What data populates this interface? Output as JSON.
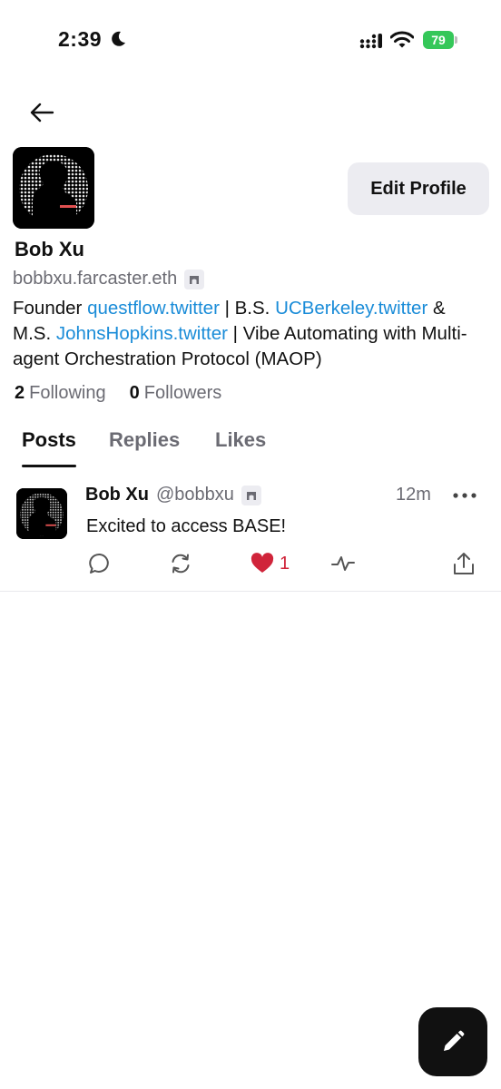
{
  "status_bar": {
    "time": "2:39",
    "battery": "79"
  },
  "profile": {
    "display_name": "Bob Xu",
    "handle": "bobbxu.farcaster.eth",
    "edit_label": "Edit Profile",
    "bio": {
      "founder_prefix": "Founder ",
      "link_questflow": "questflow.twitter",
      "bs_text": " | B.S. ",
      "link_berkeley": "UCBerkeley.twitter",
      "ms_text": " & M.S. ",
      "link_jhu": "JohnsHopkins.twitter",
      "suffix": " | Vibe Automating with Multi-agent Orchestration Protocol (MAOP)"
    },
    "following_count": "2",
    "following_label": "Following",
    "followers_count": "0",
    "followers_label": "Followers"
  },
  "tabs": {
    "posts": "Posts",
    "replies": "Replies",
    "likes": "Likes"
  },
  "post": {
    "author": "Bob Xu",
    "handle": "@bobbxu",
    "time": "12m",
    "text": "Excited to access BASE!",
    "like_count": "1"
  },
  "colors": {
    "link": "#1a8cd8",
    "like": "#d0243a",
    "battery": "#35c759",
    "button_bg": "#ececf1"
  },
  "icons": {
    "back": "arrow-left-icon",
    "reply": "speech-bubble-icon",
    "recast": "recycle-arrows-icon",
    "like": "heart-icon",
    "activity": "pulse-icon",
    "share": "share-up-icon",
    "more": "ellipsis-icon",
    "compose": "pencil-icon"
  }
}
